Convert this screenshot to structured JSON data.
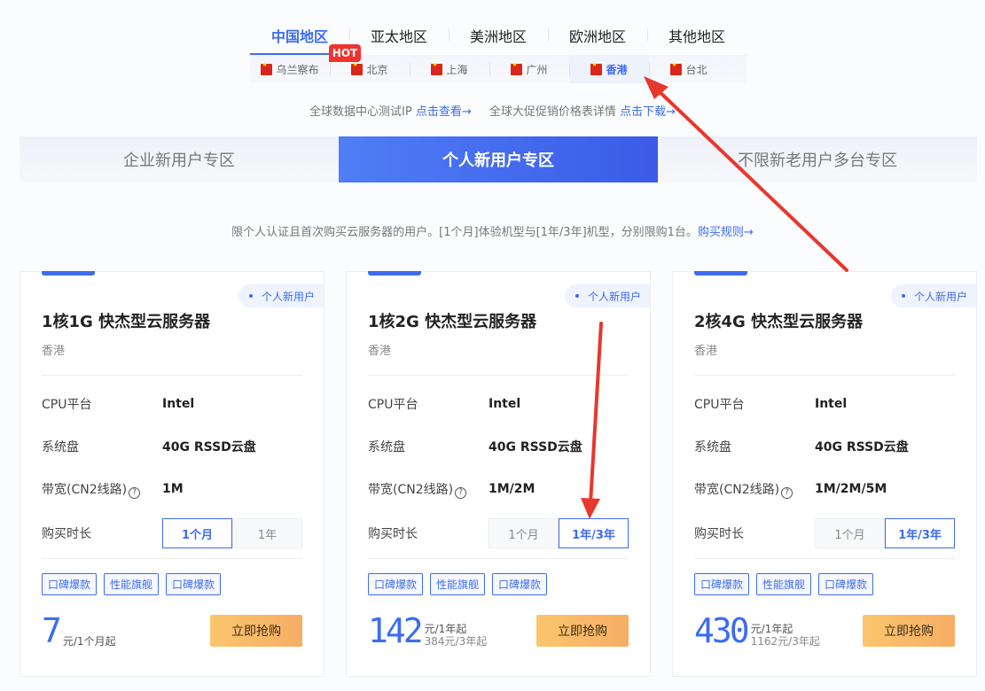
{
  "region_tabs": [
    "中国地区",
    "亚太地区",
    "美洲地区",
    "欧洲地区",
    "其他地区"
  ],
  "hot_label": "HOT",
  "cities": [
    "乌兰察布",
    "北京",
    "上海",
    "广州",
    "香港",
    "台北"
  ],
  "info": {
    "text1": "全球数据中心测试IP",
    "link1": "点击查看→",
    "text2": "全球大促促销价格表详情",
    "link2": "点击下载→"
  },
  "zone_tabs": [
    "企业新用户专区",
    "个人新用户专区",
    "不限新老用户多台专区"
  ],
  "description": {
    "text": "限个人认证且首次购买云服务器的用户。[1个月]体验机型与[1年/3年]机型，分别限购1台。",
    "link": "购买规则→"
  },
  "cards": [
    {
      "tag": "个人新用户",
      "title": "1核1G 快杰型云服务器",
      "location": "香港",
      "cpu_label": "CPU平台",
      "cpu": "Intel",
      "disk_label": "系统盘",
      "disk": "40G RSSD云盘",
      "bw_label": "带宽(CN2线路)",
      "bw_help": "?",
      "bandwidth": "1M",
      "dur_label": "购买时长",
      "durations": [
        "1个月",
        "1年"
      ],
      "labels": [
        "口碑爆款",
        "性能旗舰",
        "口碑爆款"
      ],
      "price": "7",
      "price_unit": "元/1个月起",
      "price_sub": "",
      "buy": "立即抢购"
    },
    {
      "tag": "个人新用户",
      "title": "1核2G 快杰型云服务器",
      "location": "香港",
      "cpu_label": "CPU平台",
      "cpu": "Intel",
      "disk_label": "系统盘",
      "disk": "40G RSSD云盘",
      "bw_label": "带宽(CN2线路)",
      "bw_help": "?",
      "bandwidth": "1M/2M",
      "dur_label": "购买时长",
      "durations": [
        "1个月",
        "1年/3年"
      ],
      "labels": [
        "口碑爆款",
        "性能旗舰",
        "口碑爆款"
      ],
      "price": "142",
      "price_unit": "元/1年起",
      "price_sub": "384元/3年起",
      "buy": "立即抢购"
    },
    {
      "tag": "个人新用户",
      "title": "2核4G 快杰型云服务器",
      "location": "香港",
      "cpu_label": "CPU平台",
      "cpu": "Intel",
      "disk_label": "系统盘",
      "disk": "40G RSSD云盘",
      "bw_label": "带宽(CN2线路)",
      "bw_help": "?",
      "bandwidth": "1M/2M/5M",
      "dur_label": "购买时长",
      "durations": [
        "1个月",
        "1年/3年"
      ],
      "labels": [
        "口碑爆款",
        "性能旗舰",
        "口碑爆款"
      ],
      "price": "430",
      "price_unit": "元/1年起",
      "price_sub": "1162元/3年起",
      "buy": "立即抢购"
    }
  ],
  "colors": {
    "accent": "#3d6cf0",
    "hot": "#f0332f",
    "buy_button": "#f7b567",
    "annotation_arrow": "#e8372d"
  }
}
